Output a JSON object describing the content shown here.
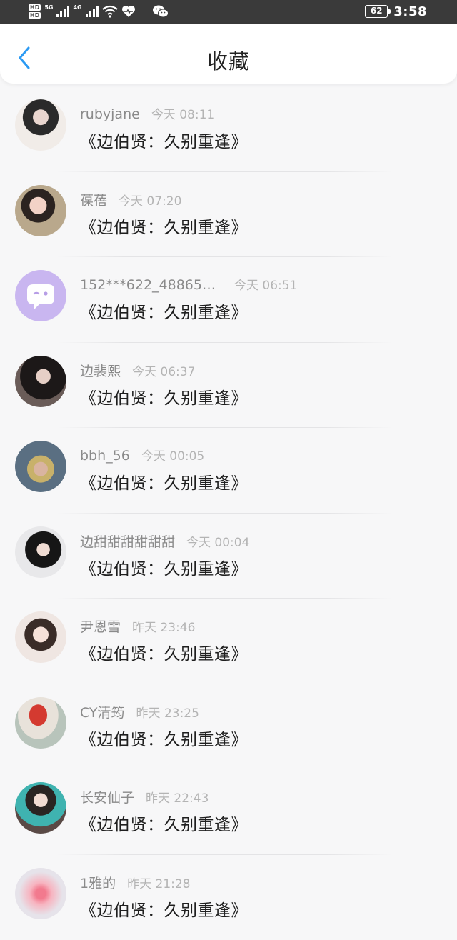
{
  "statusbar": {
    "hd_top": "HD",
    "hd_bottom": "HD",
    "net1": "5G",
    "net2": "4G",
    "battery": "62",
    "time": "3:58"
  },
  "header": {
    "title": "收藏",
    "back_icon": "chevron-left-icon",
    "accent": "#2b9af3"
  },
  "favorites": [
    {
      "user": "rubyjane",
      "time": "今天 08:11",
      "title": "《边伯贤：久别重逢》",
      "avatar": "photo"
    },
    {
      "user": "葆蓓",
      "time": "今天 07:20",
      "title": "《边伯贤：久别重逢》",
      "avatar": "photo"
    },
    {
      "user": "152***622_48865…",
      "time": "今天 06:51",
      "title": "《边伯贤：久别重逢》",
      "avatar": "chat-bubble-default"
    },
    {
      "user": "边裴熙",
      "time": "今天 06:37",
      "title": "《边伯贤：久别重逢》",
      "avatar": "photo"
    },
    {
      "user": "bbh_56",
      "time": "今天 00:05",
      "title": "《边伯贤：久别重逢》",
      "avatar": "photo"
    },
    {
      "user": "边甜甜甜甜甜甜",
      "time": "今天 00:04",
      "title": "《边伯贤：久别重逢》",
      "avatar": "photo"
    },
    {
      "user": "尹恩雪",
      "time": "昨天 23:46",
      "title": "《边伯贤：久别重逢》",
      "avatar": "photo"
    },
    {
      "user": "CY清筠",
      "time": "昨天 23:25",
      "title": "《边伯贤：久别重逢》",
      "avatar": "photo"
    },
    {
      "user": "长安仙子",
      "time": "昨天 22:43",
      "title": "《边伯贤：久别重逢》",
      "avatar": "photo"
    },
    {
      "user": "1雅的",
      "time": "昨天 21:28",
      "title": "《边伯贤：久别重逢》",
      "avatar": "blurred-pink"
    }
  ]
}
